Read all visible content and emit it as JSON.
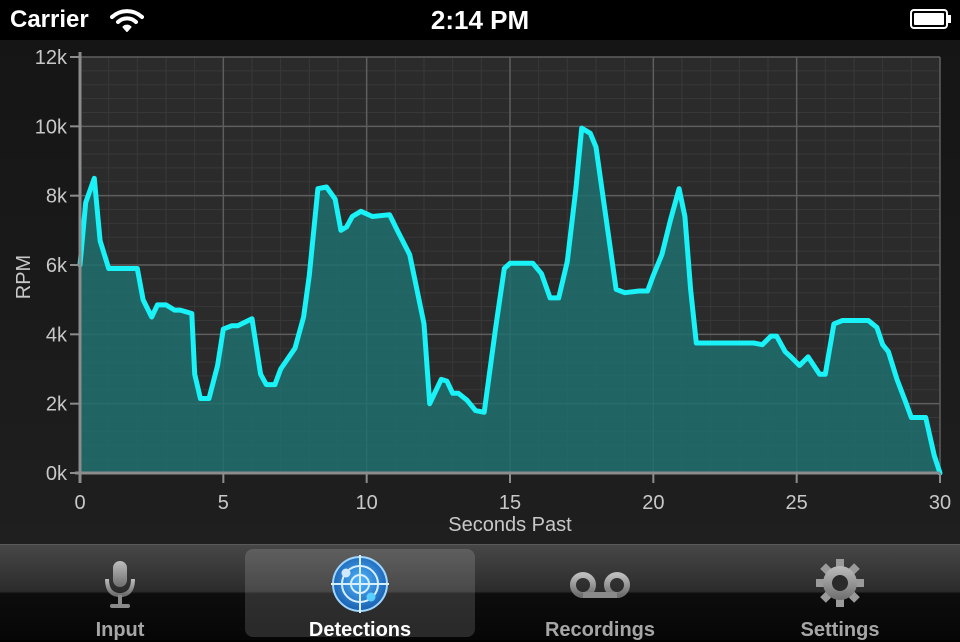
{
  "status_bar": {
    "carrier": "Carrier",
    "time": "2:14 PM"
  },
  "chart_data": {
    "type": "area",
    "xlabel": "Seconds Past",
    "ylabel": "RPM",
    "xlim": [
      0,
      30
    ],
    "ylim": [
      0,
      12000
    ],
    "x_ticks": [
      0,
      5,
      10,
      15,
      20,
      25,
      30
    ],
    "x_tick_labels": [
      "0",
      "5",
      "10",
      "15",
      "20",
      "25",
      "30"
    ],
    "y_ticks": [
      0,
      2000,
      4000,
      6000,
      8000,
      10000,
      12000
    ],
    "y_tick_labels": [
      "0k",
      "2k",
      "4k",
      "6k",
      "8k",
      "10k",
      "12k"
    ],
    "grid": true,
    "line_color": "#19f2f6",
    "fill_color": "#1f6f6f",
    "series": [
      {
        "x": [
          0,
          0.2,
          0.5,
          0.7,
          1.0,
          2.0,
          2.2,
          2.5,
          2.7,
          3.0,
          3.3,
          3.5,
          3.9,
          4.0,
          4.2,
          4.5,
          4.8,
          5.0,
          5.3,
          5.5,
          6.0,
          6.3,
          6.5,
          6.8,
          7.0,
          7.5,
          7.8,
          8.0,
          8.3,
          8.6,
          8.9,
          9.1,
          9.3,
          9.5,
          9.8,
          10.2,
          10.8,
          11.1,
          11.5,
          12.0,
          12.2,
          12.6,
          12.8,
          13.0,
          13.2,
          13.5,
          13.8,
          14.1,
          14.5,
          14.8,
          15.0,
          15.3,
          15.8,
          16.1,
          16.4,
          16.7,
          17.0,
          17.3,
          17.5,
          17.8,
          18.0,
          18.7,
          19.0,
          19.5,
          19.8,
          20.0,
          20.3,
          20.6,
          20.9,
          21.1,
          21.3,
          21.5,
          21.7,
          22.0,
          23.0,
          23.5,
          23.8,
          24.1,
          24.3,
          24.6,
          24.8,
          25.1,
          25.4,
          25.8,
          26.0,
          26.3,
          26.6,
          27.5,
          27.8,
          28.0,
          28.2,
          28.5,
          28.8,
          29.0,
          29.5,
          29.8,
          30.0
        ],
        "values": [
          6000,
          7800,
          8500,
          6700,
          5900,
          5900,
          5000,
          4500,
          4850,
          4850,
          4700,
          4700,
          4600,
          2850,
          2150,
          2150,
          3100,
          4150,
          4250,
          4250,
          4450,
          2850,
          2550,
          2550,
          3000,
          3600,
          4500,
          5700,
          8200,
          8250,
          7900,
          7000,
          7100,
          7400,
          7550,
          7400,
          7450,
          6950,
          6300,
          4300,
          2000,
          2700,
          2650,
          2300,
          2300,
          2100,
          1800,
          1750,
          4200,
          5900,
          6050,
          6050,
          6050,
          5750,
          5050,
          5050,
          6100,
          8200,
          9950,
          9800,
          9400,
          5300,
          5200,
          5250,
          5250,
          5700,
          6300,
          7300,
          8200,
          7400,
          5300,
          3750,
          3750,
          3750,
          3750,
          3750,
          3700,
          3950,
          3950,
          3500,
          3350,
          3100,
          3350,
          2850,
          2850,
          4300,
          4400,
          4400,
          4200,
          3700,
          3500,
          2700,
          2050,
          1600,
          1600,
          500,
          0
        ]
      }
    ]
  },
  "tab_bar": {
    "tabs": [
      {
        "label": "Input",
        "icon": "microphone-icon",
        "selected": false
      },
      {
        "label": "Detections",
        "icon": "radar-icon",
        "selected": true
      },
      {
        "label": "Recordings",
        "icon": "voicemail-icon",
        "selected": false
      },
      {
        "label": "Settings",
        "icon": "gear-icon",
        "selected": false
      }
    ]
  }
}
